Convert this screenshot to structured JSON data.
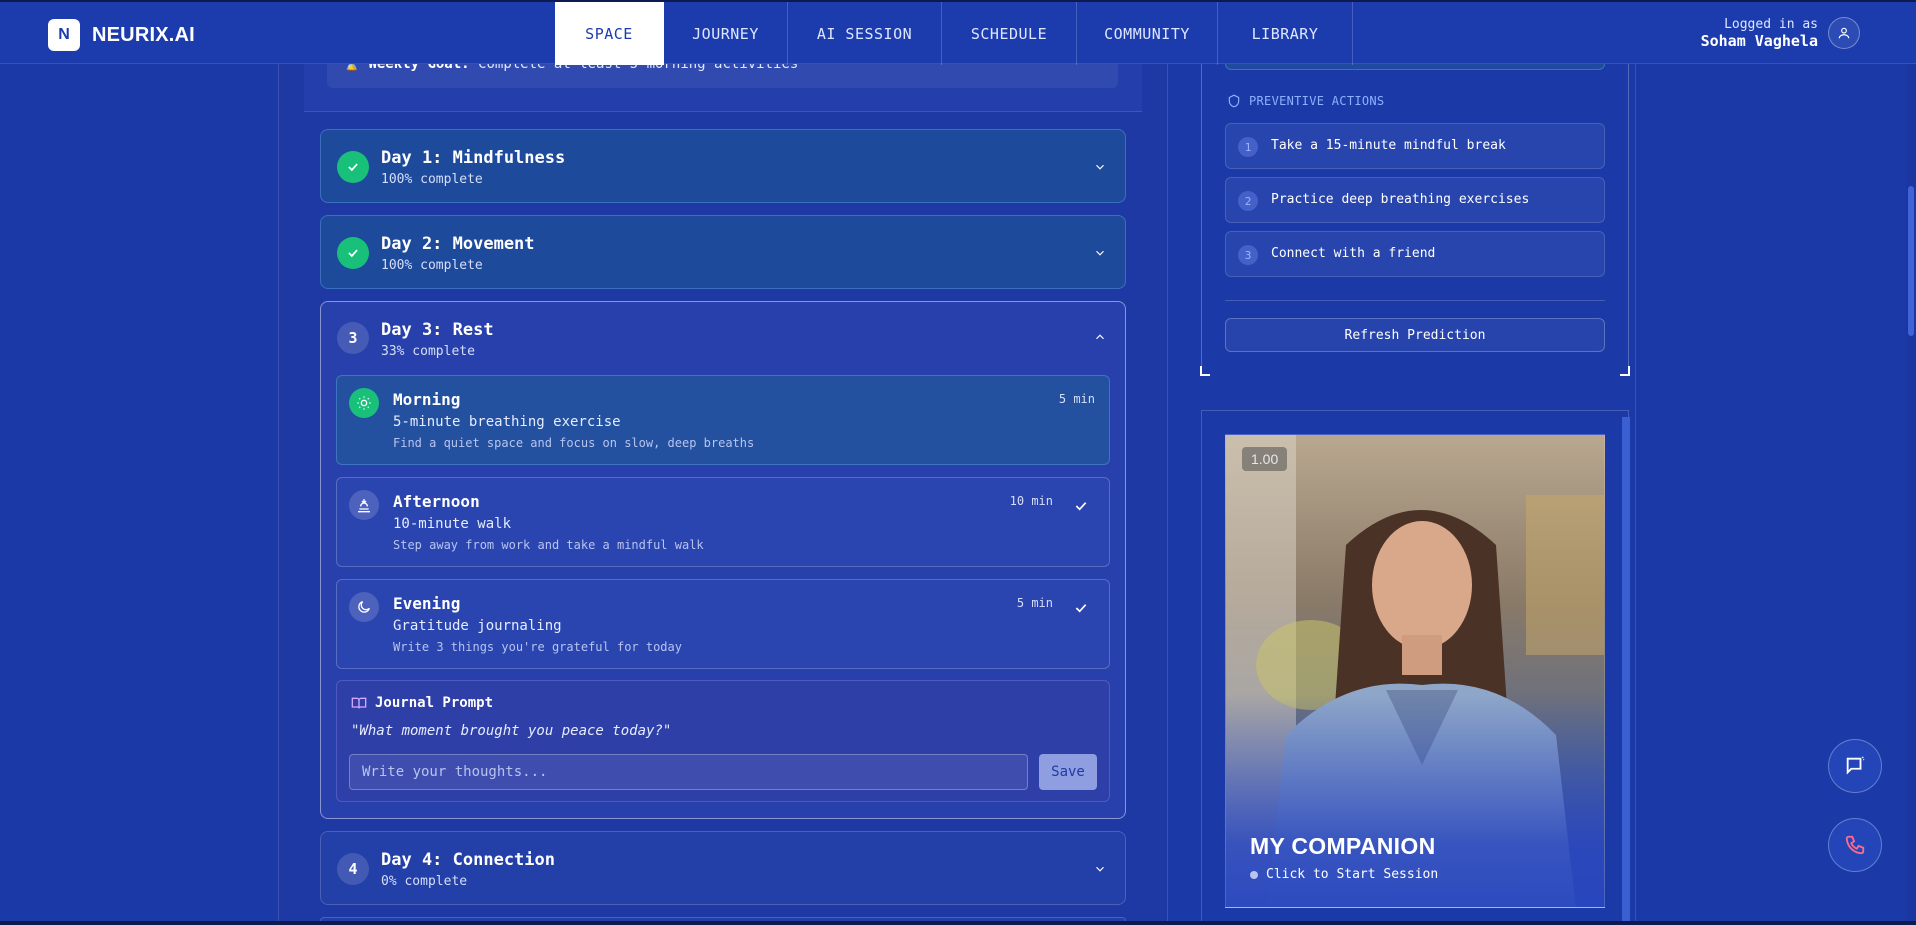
{
  "app": {
    "logo_letter": "N",
    "name": "NEURIX.AI"
  },
  "nav": {
    "tabs": [
      {
        "label": "SPACE",
        "active": true
      },
      {
        "label": "JOURNEY"
      },
      {
        "label": "AI SESSION"
      },
      {
        "label": "SCHEDULE"
      },
      {
        "label": "COMMUNITY"
      },
      {
        "label": "LIBRARY"
      }
    ]
  },
  "user": {
    "prefix": "Logged in as",
    "name": "Soham Vaghela"
  },
  "weekly_goal": {
    "label": "Weekly Goal:",
    "text": "Complete at least 5 morning activities"
  },
  "days": [
    {
      "title": "Day 1: Mindfulness",
      "progress": "100% complete",
      "completed": true
    },
    {
      "title": "Day 2: Movement",
      "progress": "100% complete",
      "completed": true
    },
    {
      "number": "3",
      "title": "Day 3: Rest",
      "progress": "33% complete",
      "expanded": true
    },
    {
      "number": "4",
      "title": "Day 4: Connection",
      "progress": "0% complete"
    }
  ],
  "activities": [
    {
      "title": "Morning",
      "name": "5-minute breathing exercise",
      "description": "Find a quiet space and focus on slow, deep breaths",
      "duration": "5 min",
      "done": true,
      "icon": "sun-icon"
    },
    {
      "title": "Afternoon",
      "name": "10-minute walk",
      "description": "Step away from work and take a mindful walk",
      "duration": "10 min",
      "icon": "sunset-icon"
    },
    {
      "title": "Evening",
      "name": "Gratitude journaling",
      "description": "Write 3 things you're grateful for today",
      "duration": "5 min",
      "icon": "moon-icon"
    }
  ],
  "journal": {
    "title": "Journal Prompt",
    "prompt": "\"What moment brought you peace today?\"",
    "placeholder": "Write your thoughts...",
    "save_label": "Save"
  },
  "prediction": {
    "preventive_title": "PREVENTIVE ACTIONS",
    "actions": [
      {
        "num": "1",
        "text": "Take a 15-minute mindful break"
      },
      {
        "num": "2",
        "text": "Practice deep breathing exercises"
      },
      {
        "num": "3",
        "text": "Connect with a friend"
      }
    ],
    "refresh_label": "Refresh Prediction"
  },
  "companion": {
    "speed": "1.00",
    "title": "MY COMPANION",
    "status": "Click to Start Session"
  },
  "colors": {
    "accent_green": "#19c07a",
    "background": "#1b3aa8",
    "nav_active_bg": "#ffffff",
    "nav_active_text": "#1c3cae"
  }
}
